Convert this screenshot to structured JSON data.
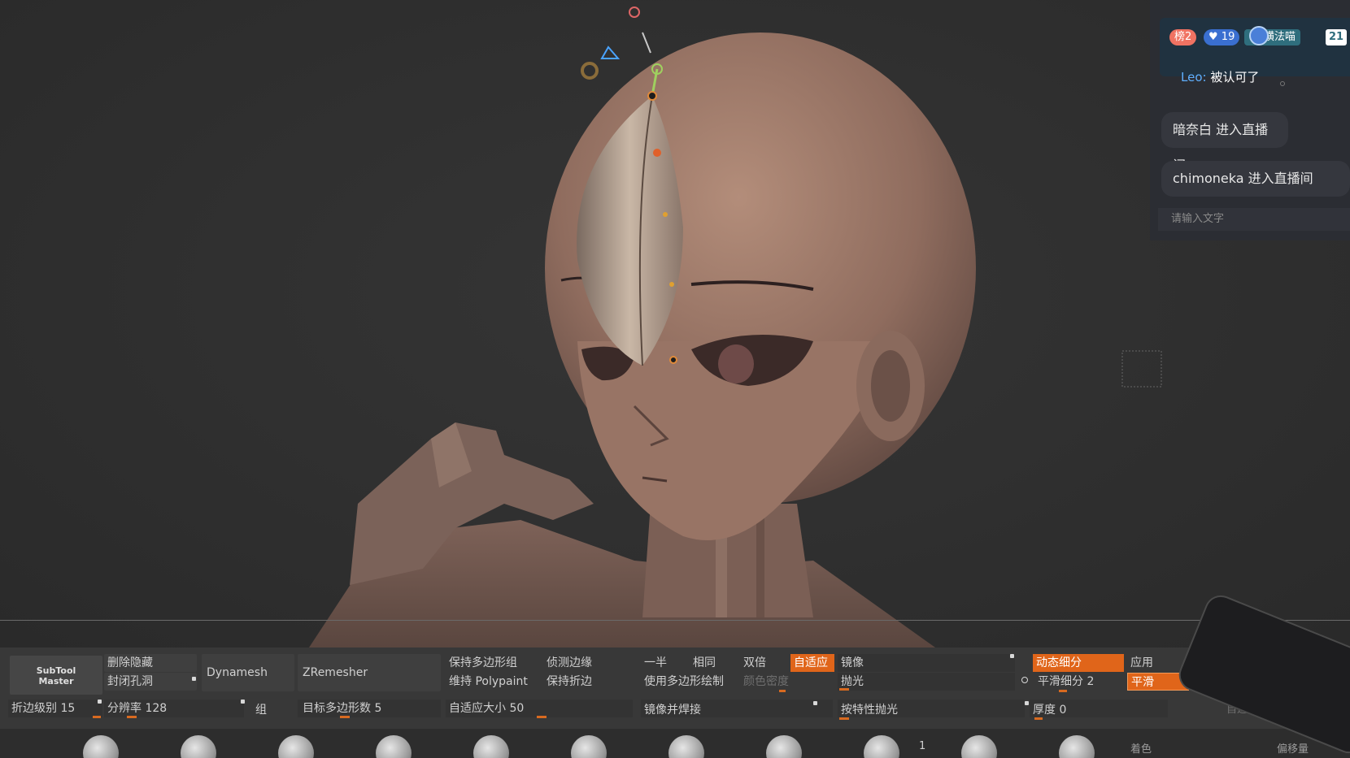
{
  "chat": {
    "badge_rank": "榜2",
    "badge_fans": "19",
    "badge_name": "横法喵",
    "badge_level": "21",
    "top_nick": "Leo:",
    "top_text": " 被认可了",
    "msg1": "暗奈白 进入直播间",
    "msg2": "chimoneka 进入直播间",
    "msg2_badge": "回归",
    "input_placeholder": "请输入文字"
  },
  "toolbar": {
    "subtool_line1": "SubTool",
    "subtool_line2": "Master",
    "delete_hidden": "删除隐藏",
    "close_holes": "封闭孔洞",
    "dynamesh": "Dynamesh",
    "zremesher": "ZRemesher",
    "keep_groups": "保持多边形组",
    "detect_edges": "侦测边缘",
    "keep_polypaint": "维持 Polypaint",
    "keep_creases": "保持折边",
    "half": "一半",
    "same": "相同",
    "double": "双倍",
    "adaptive": "自适应",
    "mirror": "镜像",
    "use_polypaint": "使用多边形绘制",
    "color_density": "颜色密度",
    "polish": "抛光",
    "dynamic_subdiv": "动态细分",
    "smooth_subdiv": "平滑细分 2",
    "apply": "应用",
    "smooth": "平滑",
    "crease_level": "折边级别 15",
    "resolution": "分辨率 128",
    "group": "组",
    "target_polycount": "目标多边形数 5",
    "adaptive_size": "自适应大小 50",
    "mirror_weld": "镜像并焊接",
    "polish_by_feature": "按特性抛光",
    "thickness": "厚度 0",
    "truncated_right": "自适",
    "brush_count": "1",
    "color_label": "着色",
    "offset_label": "偏移量"
  }
}
